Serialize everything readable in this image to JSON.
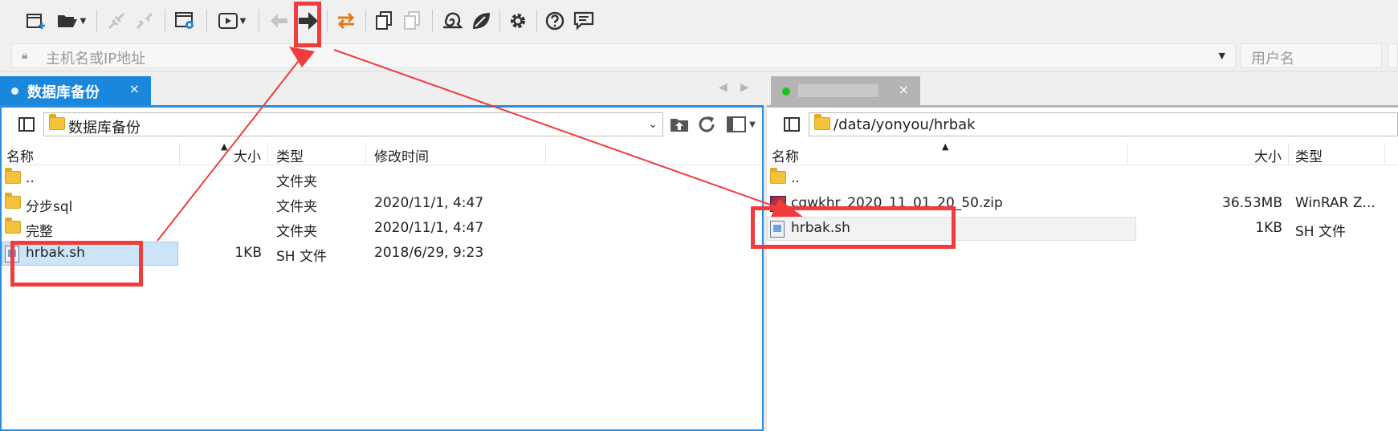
{
  "toolbar": {
    "buttons": [
      {
        "name": "new-session-icon",
        "glyph": "⊞"
      },
      {
        "name": "open-folder-icon",
        "glyph": "📂"
      },
      {
        "name": "connect-icon",
        "glyph": "⚡"
      },
      {
        "name": "disconnect-icon",
        "glyph": "⚡"
      },
      {
        "name": "session-settings-icon",
        "glyph": "⚙"
      },
      {
        "name": "play-icon",
        "glyph": "▶"
      },
      {
        "name": "back-arrow-icon",
        "glyph": "←"
      },
      {
        "name": "forward-arrow-icon",
        "glyph": "➡"
      },
      {
        "name": "sync-arrows-icon",
        "glyph": "⇄"
      },
      {
        "name": "copy-icon",
        "glyph": "❐"
      },
      {
        "name": "paste-icon",
        "glyph": "❐"
      },
      {
        "name": "spiral-icon",
        "glyph": "◉"
      },
      {
        "name": "leaf-icon",
        "glyph": "❦"
      },
      {
        "name": "gear-icon",
        "glyph": "⚙"
      },
      {
        "name": "help-icon",
        "glyph": "?"
      },
      {
        "name": "chat-icon",
        "glyph": "💬"
      }
    ]
  },
  "address": {
    "host_placeholder": "主机名或IP地址",
    "user_placeholder": "用户名"
  },
  "tabs": {
    "left_label": "数据库备份",
    "close_glyph": "×",
    "nav_prev": "◀",
    "nav_next": "▶"
  },
  "left": {
    "path": "数据库备份",
    "headers": {
      "name": "名称",
      "size": "大小",
      "type": "类型",
      "modified": "修改时间"
    },
    "rows": [
      {
        "name": "..",
        "size": "",
        "type": "文件夹",
        "modified": "",
        "icon": "folder"
      },
      {
        "name": "分步sql",
        "size": "",
        "type": "文件夹",
        "modified": "2020/11/1, 4:47",
        "icon": "folder"
      },
      {
        "name": "完整",
        "size": "",
        "type": "文件夹",
        "modified": "2020/11/1, 4:47",
        "icon": "folder"
      },
      {
        "name": "hrbak.sh",
        "size": "1KB",
        "type": "SH 文件",
        "modified": "2018/6/29, 9:23",
        "icon": "file"
      }
    ]
  },
  "right": {
    "path": "/data/yonyou/hrbak",
    "headers": {
      "name": "名称",
      "size": "大小",
      "type": "类型"
    },
    "rows": [
      {
        "name": "..",
        "size": "",
        "type": "",
        "icon": "folder"
      },
      {
        "name": "cqwkhr_2020_11_01_20_50.zip",
        "size": "36.53MB",
        "type": "WinRAR Z...",
        "icon": "zip"
      },
      {
        "name": "hrbak.sh",
        "size": "1KB",
        "type": "SH 文件",
        "icon": "file"
      }
    ]
  },
  "colors": {
    "accent": "#1a86dc",
    "annotation": "#f03c3c",
    "status_connected": "#1bc21b"
  }
}
